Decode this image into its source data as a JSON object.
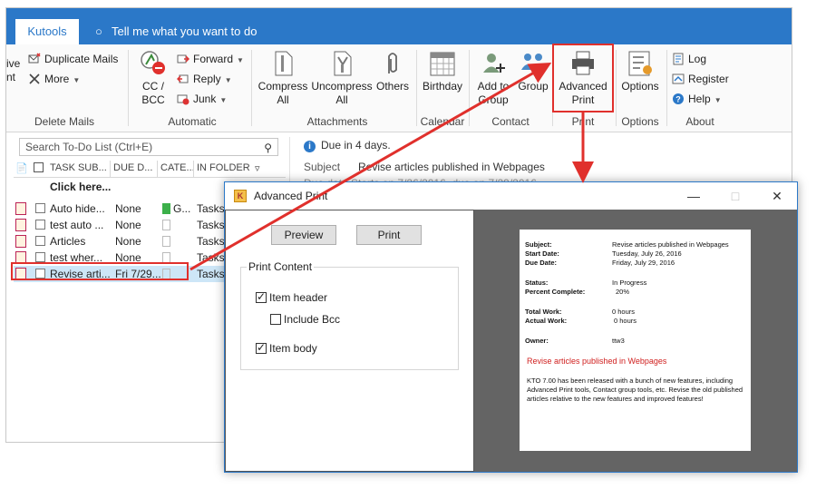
{
  "outlook": {
    "tab": "Kutools",
    "tell_me": "Tell me what you want to do",
    "ribbon": {
      "delete_mails": {
        "label": "Delete Mails",
        "partial_top": "ive",
        "partial_bottom": "nt",
        "duplicate": "Duplicate Mails",
        "more": "More"
      },
      "automatic": {
        "label": "Automatic",
        "cc_bcc": "CC /\nBCC",
        "forward": "Forward",
        "reply": "Reply",
        "junk": "Junk"
      },
      "attachments": {
        "label": "Attachments",
        "compress": "Compress\nAll",
        "uncompress": "Uncompress\nAll",
        "others": "Others"
      },
      "calendar": {
        "label": "Calendar",
        "birthday": "Birthday"
      },
      "contact": {
        "label": "Contact",
        "add_to_group": "Add to\nGroup",
        "group": "Group"
      },
      "print": {
        "label": "Print",
        "advanced": "Advanced\nPrint"
      },
      "options": {
        "label": "Options",
        "options": "Options"
      },
      "about": {
        "label": "About",
        "log": "Log",
        "register": "Register",
        "help": "Help"
      }
    },
    "search_placeholder": "Search To-Do List (Ctrl+E)",
    "columns": [
      "TASK SUB...",
      "DUE D...",
      "CATE...",
      "IN FOLDER"
    ],
    "click_here": "Click here...",
    "tasks": [
      {
        "subject": "Auto hide...",
        "due": "None",
        "category": "G...",
        "folder": "Tasks"
      },
      {
        "subject": "test auto ...",
        "due": "None",
        "category": "",
        "folder": "Tasks"
      },
      {
        "subject": "Articles",
        "due": "None",
        "category": "",
        "folder": "Tasks"
      },
      {
        "subject": "test wher...",
        "due": "None",
        "category": "",
        "folder": "Tasks 2"
      },
      {
        "subject": "Revise arti...",
        "due": "Fri 7/29...",
        "category": "",
        "folder": "Tasks"
      }
    ],
    "reading": {
      "due_info": "Due in 4 days.",
      "subject_label": "Subject",
      "subject_value": "Revise articles published in Webpages",
      "start_line": "Due date    Starts on 7/26/2016, due on 7/29/2016"
    }
  },
  "dialog": {
    "title": "Advanced Print",
    "preview_btn": "Preview",
    "print_btn": "Print",
    "group_label": "Print Content",
    "options": [
      {
        "label": "Item header",
        "checked": true
      },
      {
        "label": "Include Bcc",
        "checked": false
      },
      {
        "label": "Item body",
        "checked": true
      }
    ],
    "preview": {
      "subject_label": "Subject:",
      "subject": "Revise articles published in Webpages",
      "start_label": "Start Date:",
      "start": "Tuesday, July 26, 2016",
      "due_label": "Due Date:",
      "due": "Friday, July 29, 2016",
      "status_label": "Status:",
      "status": "In Progress",
      "percent_label": "Percent Complete:",
      "percent": "20%",
      "total_label": "Total Work:",
      "total": "0 hours",
      "actual_label": "Actual Work:",
      "actual": "0 hours",
      "owner_label": "Owner:",
      "owner": "ttw3",
      "red_subject": "Revise articles published in Webpages",
      "body": "KTO 7.00 has been released with a bunch of new features, including Advanced Print tools, Contact group tools, etc. Revise the old published articles relative to the new features and improved features!"
    }
  },
  "colors": {
    "accent": "#2b78c8",
    "highlight": "#e0302c",
    "preview_bg": "#646464"
  }
}
